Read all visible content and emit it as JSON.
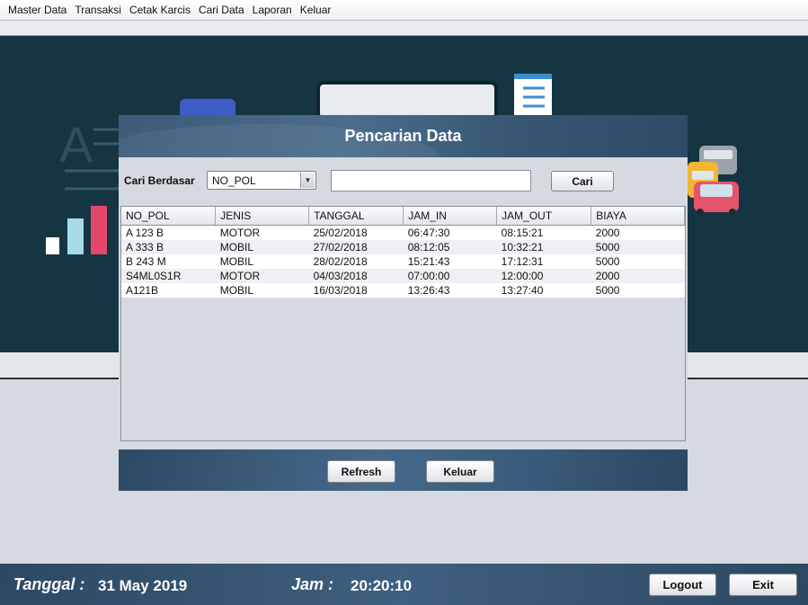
{
  "menu": [
    "Master Data",
    "Transaksi",
    "Cetak Karcis",
    "Cari Data",
    "Laporan",
    "Keluar"
  ],
  "dialog": {
    "title": "Pencarian Data",
    "search_label": "Cari Berdasar",
    "search_field_selected": "NO_POL",
    "search_value": "",
    "search_button": "Cari",
    "refresh_button": "Refresh",
    "close_button": "Keluar"
  },
  "table": {
    "columns": [
      "NO_POL",
      "JENIS",
      "TANGGAL",
      "JAM_IN",
      "JAM_OUT",
      "BIAYA"
    ],
    "rows": [
      [
        "A 123 B",
        "MOTOR",
        "25/02/2018",
        "06:47:30",
        "08:15:21",
        "2000"
      ],
      [
        "A 333 B",
        "MOBIL",
        "27/02/2018",
        "08:12:05",
        "10:32:21",
        "5000"
      ],
      [
        "B 243 M",
        "MOBIL",
        "28/02/2018",
        "15:21:43",
        "17:12:31",
        "5000"
      ],
      [
        "S4ML0S1R",
        "MOTOR",
        "04/03/2018",
        "07:00:00",
        "12:00:00",
        "2000"
      ],
      [
        "A121B",
        "MOBIL",
        "16/03/2018",
        "13:26:43",
        "13:27:40",
        "5000"
      ]
    ]
  },
  "status": {
    "date_label": "Tanggal :",
    "date_value": "31 May 2019",
    "time_label": "Jam :",
    "time_value": "20:20:10",
    "logout_button": "Logout",
    "exit_button": "Exit"
  },
  "colors": {
    "banner": "#163543",
    "header_blue": "#3b5b78",
    "window_bg": "#d6d9e0"
  }
}
